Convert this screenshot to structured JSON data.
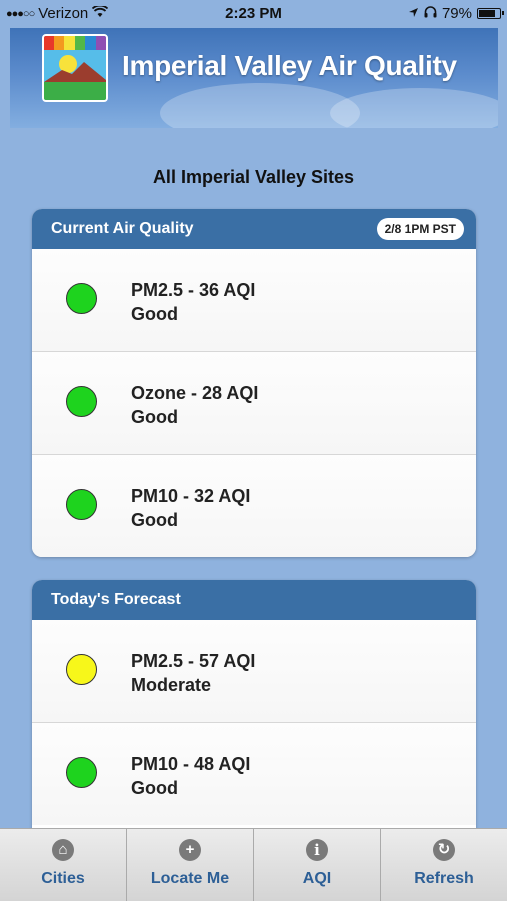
{
  "status_bar": {
    "carrier": "Verizon",
    "time": "2:23 PM",
    "battery": "79%"
  },
  "banner": {
    "title": "Imperial Valley Air Quality"
  },
  "page": {
    "heading": "All Imperial Valley Sites"
  },
  "current": {
    "title": "Current Air Quality",
    "badge": "2/8 1PM PST",
    "items": [
      {
        "label": "PM2.5 - 36 AQI",
        "status": "Good",
        "color": "#1ed31e"
      },
      {
        "label": "Ozone - 28 AQI",
        "status": "Good",
        "color": "#1ed31e"
      },
      {
        "label": "PM10 - 32 AQI",
        "status": "Good",
        "color": "#1ed31e"
      }
    ]
  },
  "forecast": {
    "title": "Today's Forecast",
    "items": [
      {
        "label": "PM2.5 - 57 AQI",
        "status": "Moderate",
        "color": "#f7f71a"
      },
      {
        "label": "PM10 - 48 AQI",
        "status": "Good",
        "color": "#1ed31e"
      }
    ]
  },
  "tabs": [
    {
      "label": "Cities",
      "icon": "home-icon",
      "glyph": "⌂"
    },
    {
      "label": "Locate Me",
      "icon": "plus-icon",
      "glyph": "+"
    },
    {
      "label": "AQI",
      "icon": "info-icon",
      "glyph": "i"
    },
    {
      "label": "Refresh",
      "icon": "refresh-icon",
      "glyph": "↻"
    }
  ]
}
